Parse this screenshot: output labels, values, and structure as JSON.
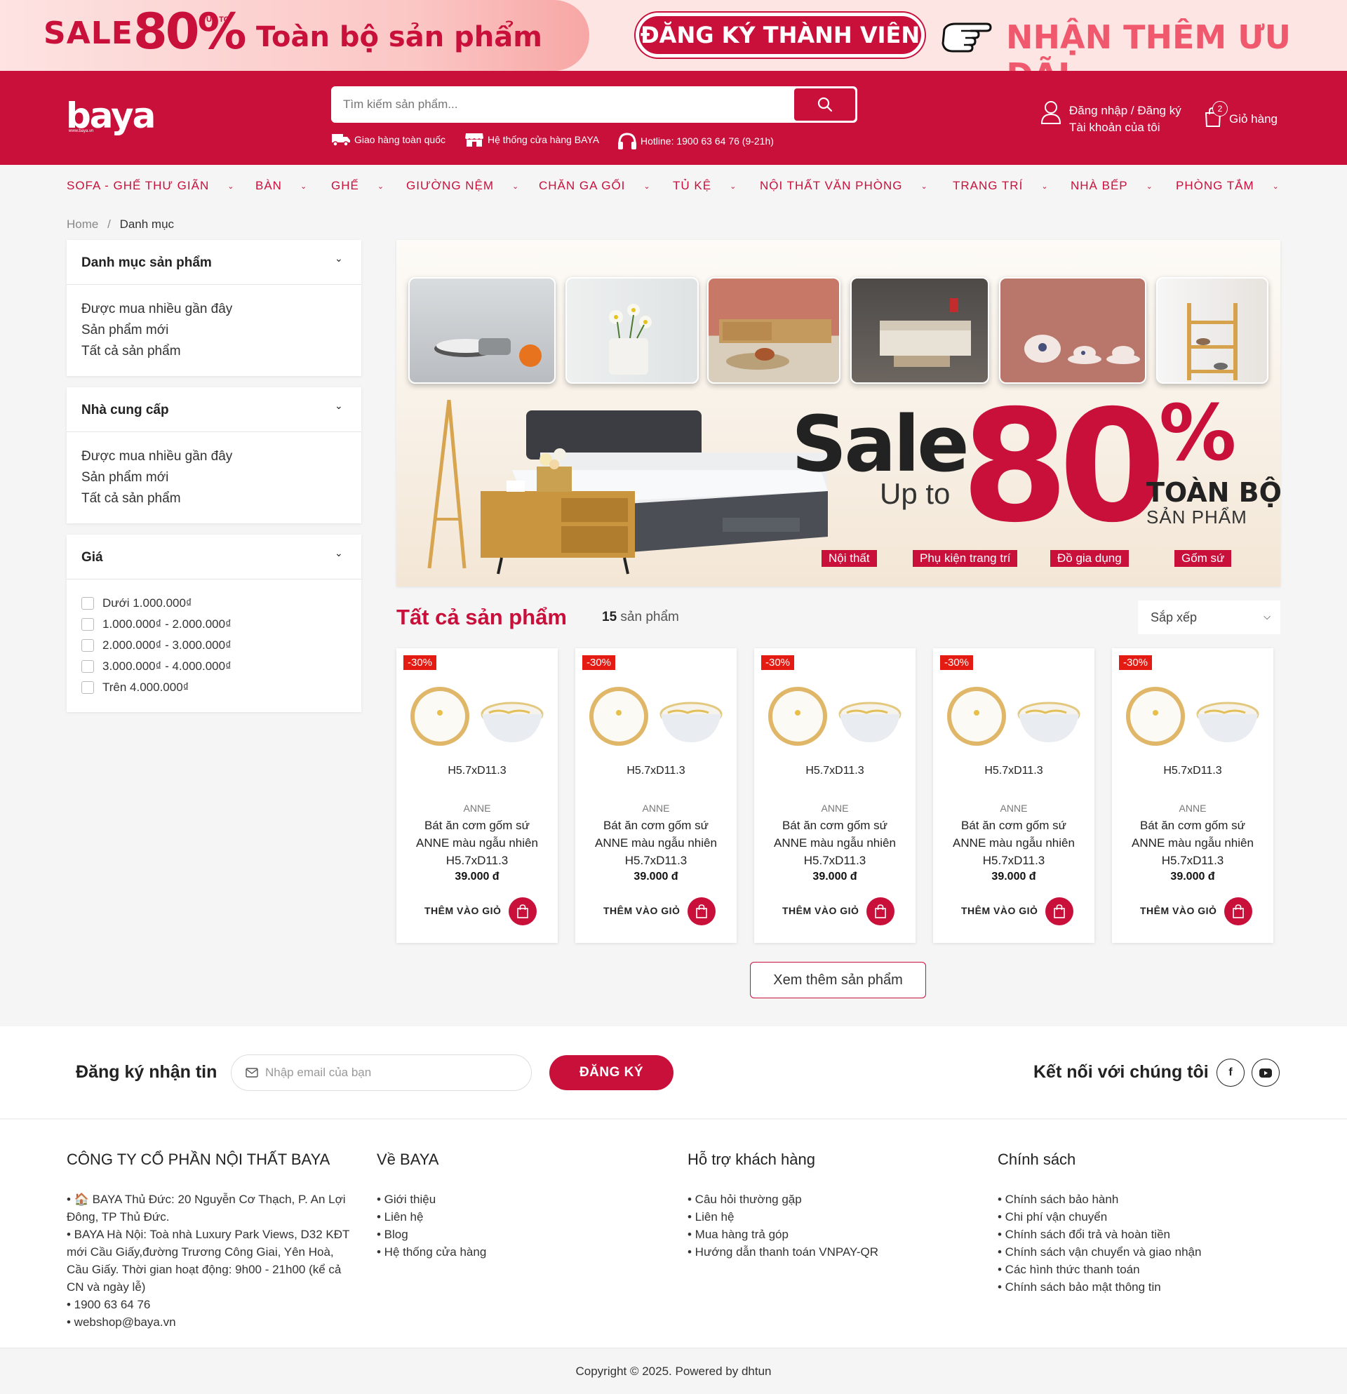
{
  "promo": {
    "sale": "SALE",
    "percent": "80%",
    "up_to": "UP TO",
    "all_products": "Toàn bộ sản phẩm",
    "register_button": "ĐĂNG KÝ THÀNH VIÊN",
    "more_offers": "NHẬN THÊM ƯU ĐÃI"
  },
  "header": {
    "logo": "baya",
    "logo_sub": "www.baya.vn",
    "search_placeholder": "Tìm kiếm sản phẩm...",
    "shipping": "Giao hàng toàn quốc",
    "stores": "Hệ thống cửa hàng BAYA",
    "hotline": "Hotline: 1900 63 64 76 (9-21h)",
    "login": "Đăng nhập / Đăng ký",
    "account": "Tài khoản của tôi",
    "cart_count": "2",
    "cart_label": "Giỏ hàng"
  },
  "nav": [
    "SOFA - GHẾ THƯ GIÃN",
    "BÀN",
    "GHẾ",
    "GIƯỜNG NỆM",
    "CHĂN GA GỐI",
    "TỦ KỆ",
    "NỘI THẤT VĂN PHÒNG",
    "TRANG TRÍ",
    "NHÀ BẾP",
    "PHÒNG TẮM"
  ],
  "breadcrumb": {
    "home": "Home",
    "separator": "/",
    "current": "Danh mục"
  },
  "sidebar": {
    "category": {
      "title": "Danh mục sản phẩm",
      "items": [
        "Được mua nhiều gần đây",
        "Sản phẩm mới",
        "Tất cả sản phẩm"
      ]
    },
    "supplier": {
      "title": "Nhà cung cấp",
      "items": [
        "Được mua nhiều gần đây",
        "Sản phẩm mới",
        "Tất cả sản phẩm"
      ]
    },
    "price": {
      "title": "Giá",
      "items": [
        "Dưới 1.000.000₫",
        "1.000.000₫ - 2.000.000₫",
        "2.000.000₫ - 3.000.000₫",
        "3.000.000₫ - 4.000.000₫",
        "Trên 4.000.000₫"
      ]
    }
  },
  "banner": {
    "sale": "Sale",
    "up_to": "Up to",
    "number": "80",
    "percent": "%",
    "all": "TOÀN BỘ",
    "products": "SẢN PHẨM",
    "tags": [
      "Nội thất",
      "Phụ kiện trang trí",
      "Đồ gia dụng",
      "Gốm sứ"
    ]
  },
  "products_section": {
    "title": "Tất cả sản phẩm",
    "count": "15",
    "count_label": "sản phẩm",
    "sort_label": "Sắp xếp",
    "more_button": "Xem thêm sản phẩm"
  },
  "products": [
    {
      "badge": "-30%",
      "size": "H5.7xD11.3",
      "brand": "ANNE",
      "name": "Bát ăn cơm gốm sứ ANNE màu ngẫu nhiên H5.7xD11.3",
      "price": "39.000 đ",
      "add": "THÊM VÀO GIỎ"
    },
    {
      "badge": "-30%",
      "size": "H5.7xD11.3",
      "brand": "ANNE",
      "name": "Bát ăn cơm gốm sứ ANNE màu ngẫu nhiên H5.7xD11.3",
      "price": "39.000 đ",
      "add": "THÊM VÀO GIỎ"
    },
    {
      "badge": "-30%",
      "size": "H5.7xD11.3",
      "brand": "ANNE",
      "name": "Bát ăn cơm gốm sứ ANNE màu ngẫu nhiên H5.7xD11.3",
      "price": "39.000 đ",
      "add": "THÊM VÀO GIỎ"
    },
    {
      "badge": "-30%",
      "size": "H5.7xD11.3",
      "brand": "ANNE",
      "name": "Bát ăn cơm gốm sứ ANNE màu ngẫu nhiên H5.7xD11.3",
      "price": "39.000 đ",
      "add": "THÊM VÀO GIỎ"
    },
    {
      "badge": "-30%",
      "size": "H5.7xD11.3",
      "brand": "ANNE",
      "name": "Bát ăn cơm gốm sứ ANNE màu ngẫu nhiên H5.7xD11.3",
      "price": "39.000 đ",
      "add": "THÊM VÀO GIỎ"
    }
  ],
  "newsletter": {
    "title": "Đăng ký nhận tin",
    "placeholder": "Nhập email của bạn",
    "button": "ĐĂNG KÝ",
    "connect": "Kết nối với chúng tôi"
  },
  "footer": {
    "company": {
      "title": "CÔNG TY CỔ PHẦN NỘI THẤT BAYA",
      "lines": [
        "• 🏠 BAYA Thủ Đức: 20 Nguyễn Cơ Thạch, P. An Lợi Đông, TP Thủ Đức.",
        "• BAYA Hà Nội: Toà nhà Luxury Park Views, D32 KĐT mới Cầu Giấy,đường Trương Công Giai, Yên Hoà, Cầu Giấy. Thời gian hoạt động: 9h00 - 21h00 (kể cả CN và ngày lễ)",
        "• 1900 63 64 76",
        "• webshop@baya.vn"
      ]
    },
    "about": {
      "title": "Về BAYA",
      "items": [
        "• Giới thiệu",
        "• Liên hệ",
        "• Blog",
        "• Hệ thống cửa hàng"
      ]
    },
    "support": {
      "title": "Hỗ trợ khách hàng",
      "items": [
        "• Câu hỏi thường gặp",
        "• Liên hệ",
        "• Mua hàng trả góp",
        "• Hướng dẫn thanh toán VNPAY-QR"
      ]
    },
    "policy": {
      "title": "Chính sách",
      "items": [
        "• Chính sách bảo hành",
        "• Chi phí vận chuyển",
        "• Chính sách đổi trả và hoàn tiền",
        "• Chính sách vận chuyển và giao nhận",
        "• Các hình thức thanh toán",
        "• Chính sách bảo mật thông tin"
      ]
    },
    "copyright": "Copyright © 2025. Powered by dhtun"
  },
  "colors": {
    "brand": "#c8103b",
    "badge": "#e41b13",
    "background": "#f5f5f5"
  }
}
